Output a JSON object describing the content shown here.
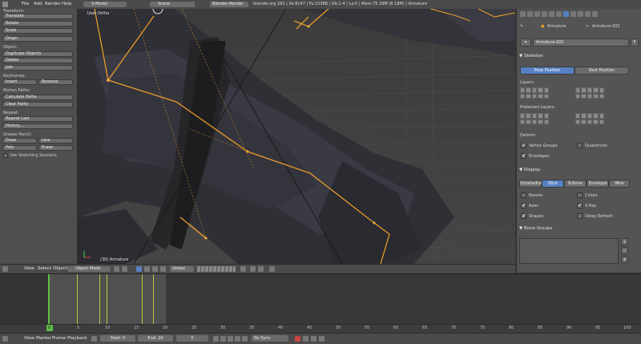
{
  "topbar": {
    "menus": [
      "File",
      "Add",
      "Render",
      "Help"
    ],
    "screen_layout": "3-Model",
    "scene": "Scene",
    "render_engine": "Blender Render",
    "info": "blender.org 262 | Ve:8147 | Fa:15388 | Ob:1-4 | La:0 | Mem:75.39M (8.18M) | Armature"
  },
  "toolshelf": {
    "transform_header": "Transform:",
    "translate": "Translate",
    "rotate": "Rotate",
    "scale": "Scale",
    "origin": "Origin",
    "object_header": "Object:",
    "duplicate": "Duplicate Objects",
    "delete": "Delete",
    "join": "Join",
    "keyframes_header": "Keyframes:",
    "insert": "Insert",
    "remove": "Remove",
    "motion_header": "Motion Paths:",
    "calculate": "Calculate Paths",
    "clear_paths": "Clear Paths",
    "repeat_header": "Repeat:",
    "repeat_last": "Repeat Last",
    "history": "History...",
    "grease_header": "Grease Pencil:",
    "draw": "Draw",
    "line": "Line",
    "poly": "Poly",
    "erase": "Erase",
    "sketching": "Use Sketching Sessions"
  },
  "viewport": {
    "view_label": "User Ortho",
    "object_label": "(30) Armature"
  },
  "viewport_header": {
    "view": "View",
    "select": "Select",
    "object": "Object",
    "mode": "Object Mode",
    "orientation": "Global"
  },
  "props": {
    "context_armature": "Armature",
    "context_data": "Armature.002",
    "datablock": "Armature.002",
    "skeleton_header": "Skeleton",
    "pose_position": "Pose Position",
    "rest_position": "Rest Position",
    "layers_label": "Layers:",
    "protected_label": "Protected Layers:",
    "deform_label": "Deform:",
    "vertex_groups": "Vertex Groups",
    "quaternion": "Quaternion",
    "envelopes": "Envelopes",
    "display_header": "Display",
    "display_modes": [
      "Octahedral",
      "Stick",
      "B-Bone",
      "Envelope",
      "Wire"
    ],
    "active_display": "Stick",
    "names": "Names",
    "colors": "Colors",
    "axes": "Axes",
    "xray": "X-Ray",
    "shapes": "Shapes",
    "delay_refresh": "Delay Refresh",
    "bone_groups_header": "Bone Groups",
    "accent_color": "#5680c2"
  },
  "timeline": {
    "ticks": [
      "0",
      "5",
      "10",
      "15",
      "20",
      "25",
      "30",
      "35",
      "40",
      "45",
      "50",
      "55",
      "60",
      "65",
      "70",
      "75",
      "80",
      "85",
      "90",
      "95",
      "100"
    ],
    "current_frame_tick": "0"
  },
  "timeline_header": {
    "view": "View",
    "marker": "Marker",
    "frame": "Frame",
    "playback": "Playback",
    "start": "Start: 0",
    "end": "End: 20",
    "current": "0",
    "sync": "No Sync"
  }
}
